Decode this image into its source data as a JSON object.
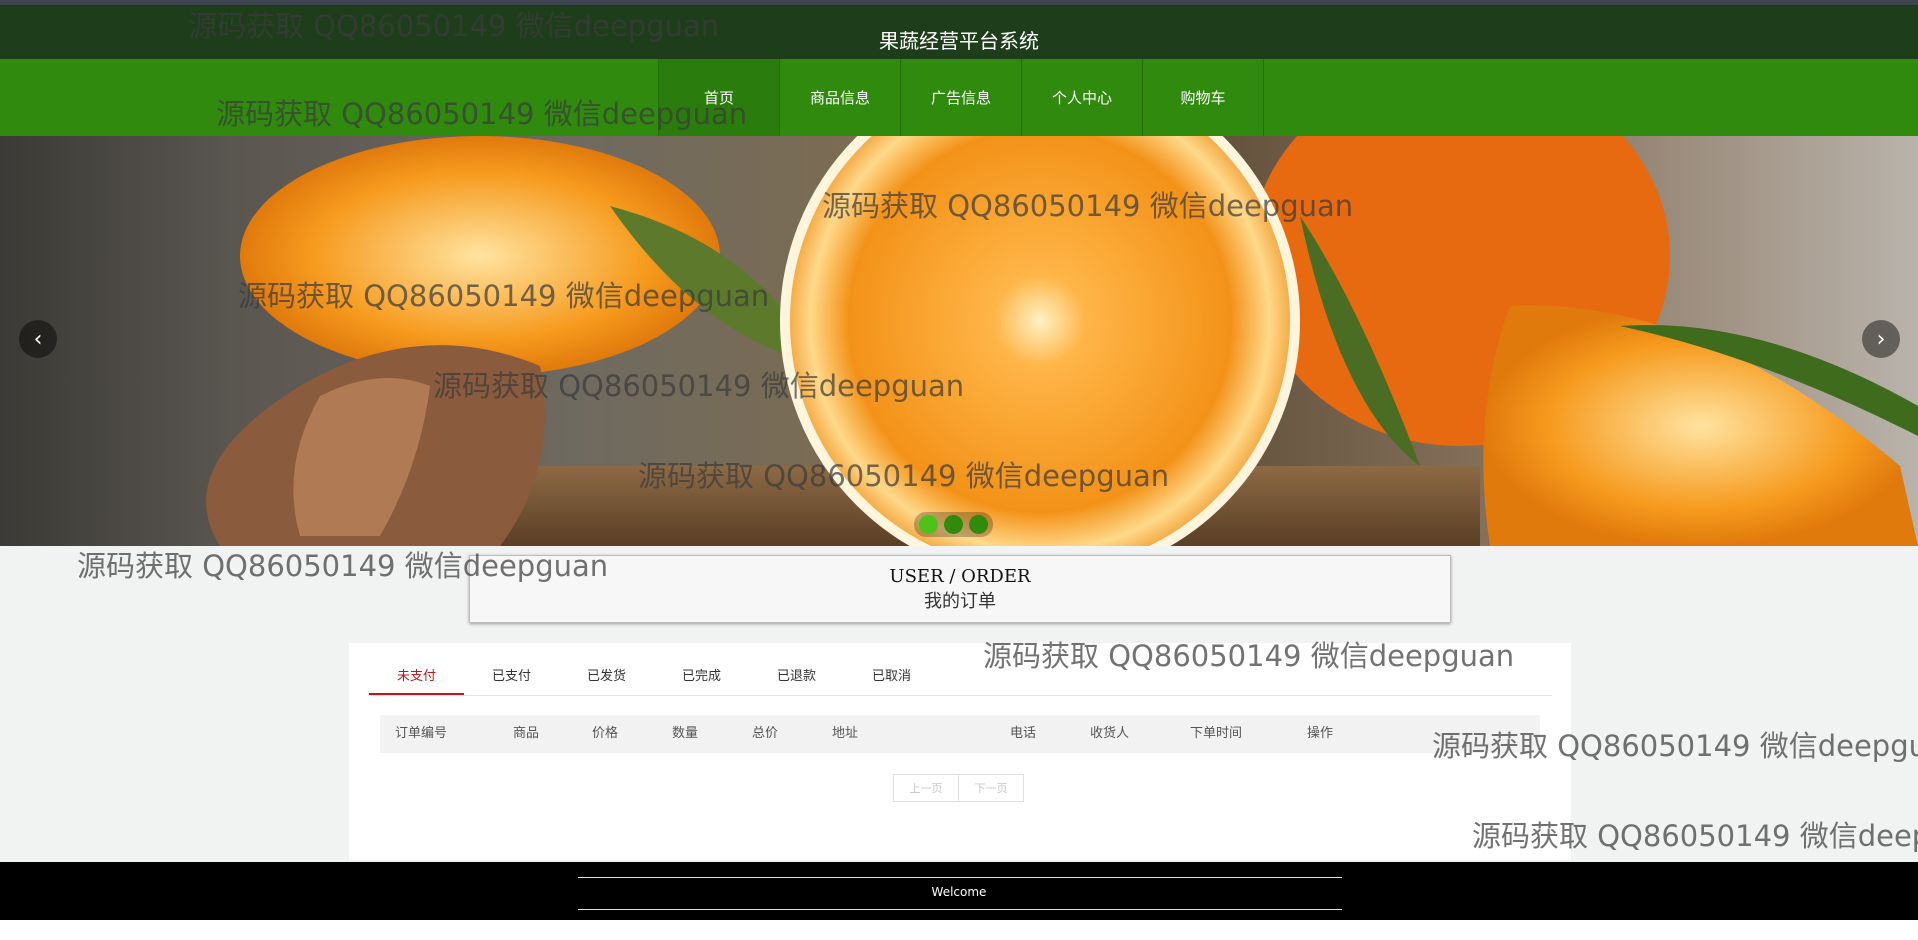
{
  "header": {
    "title": "果蔬经营平台系统"
  },
  "nav": {
    "items": [
      "首页",
      "商品信息",
      "广告信息",
      "个人中心",
      "购物车"
    ]
  },
  "banner": {
    "prev_symbol": "‹",
    "next_symbol": "›",
    "slide_count": 3,
    "active_slide": 1
  },
  "order_title": {
    "en": "USER / ORDER",
    "cn": "我的订单"
  },
  "tabs": [
    "未支付",
    "已支付",
    "已发货",
    "已完成",
    "已退款",
    "已取消"
  ],
  "table": {
    "headers": [
      "订单编号",
      "商品",
      "价格",
      "数量",
      "总价",
      "地址",
      "电话",
      "收货人",
      "下单时间",
      "操作"
    ]
  },
  "pager": {
    "prev": "上一页",
    "next": "下一页"
  },
  "footer": {
    "welcome": "Welcome"
  },
  "watermark": "源码获取 QQ86050149 微信deepguan",
  "colors": {
    "header_bg": "#1e3d1a",
    "nav_bg": "#2f8a0e",
    "active_tab": "#c0171c"
  }
}
